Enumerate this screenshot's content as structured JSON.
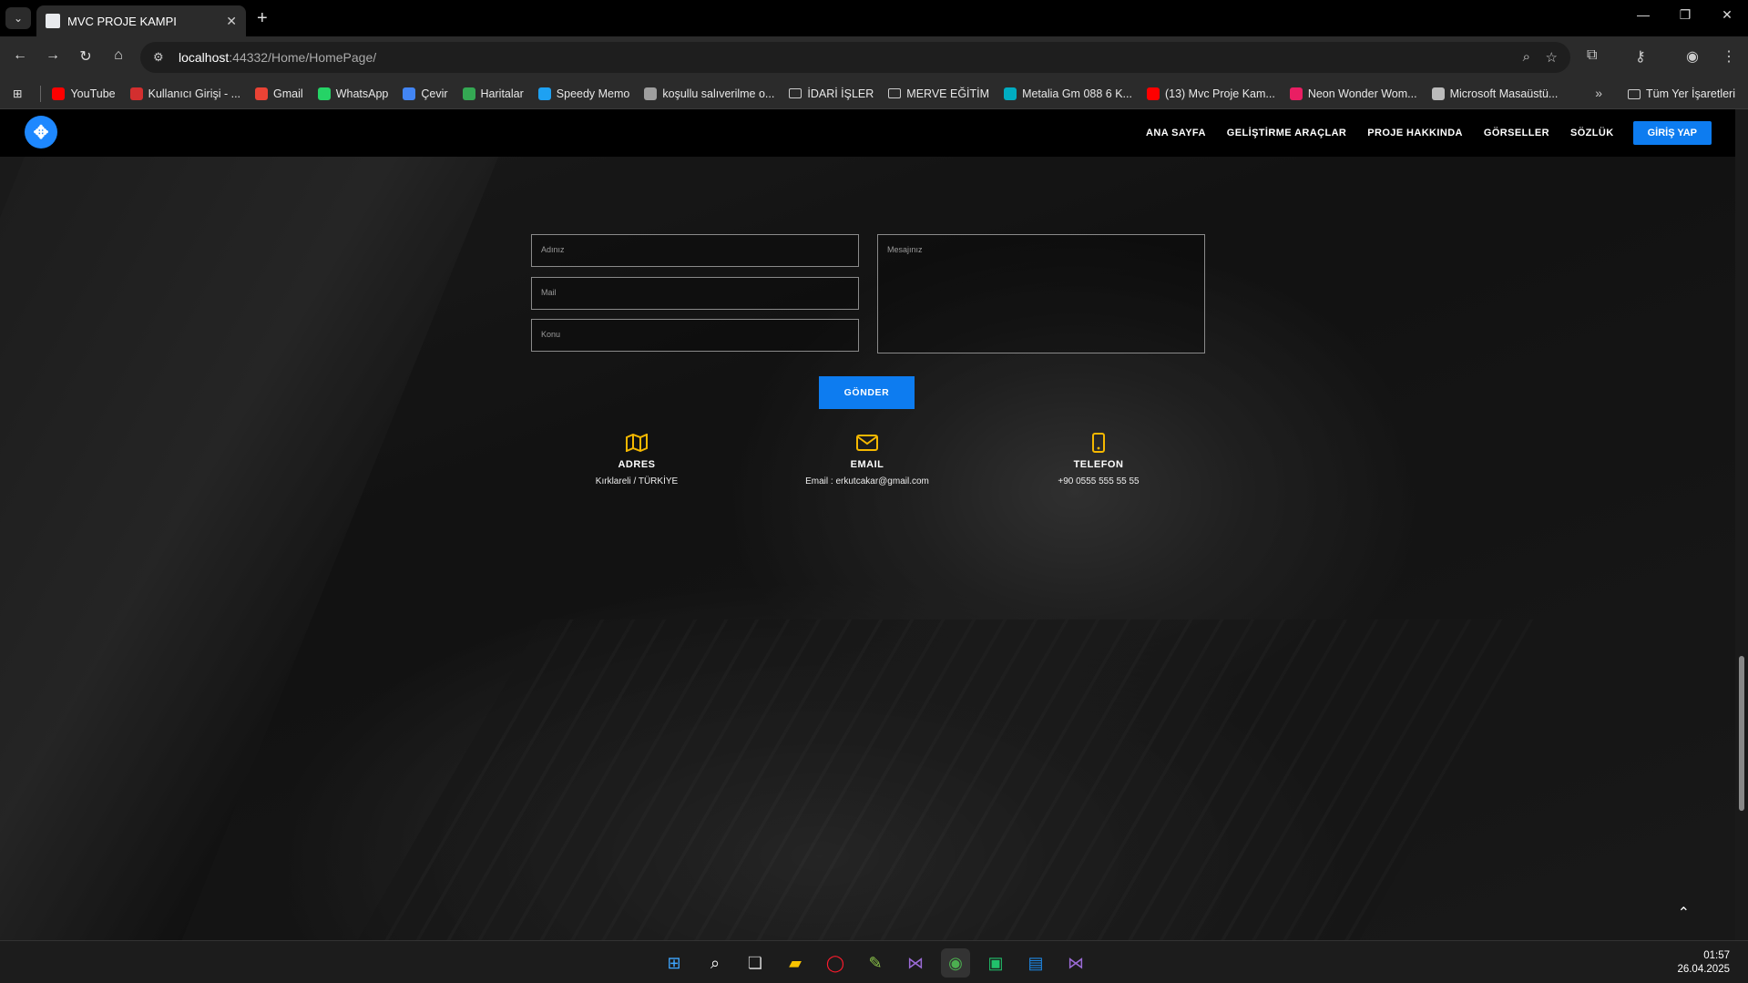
{
  "browser": {
    "tab_title": "MVC PROJE KAMPI",
    "url_host": "localhost",
    "url_rest": ":44332/Home/HomePage/",
    "bookmarks": [
      {
        "label": "YouTube",
        "color": "#ff0000"
      },
      {
        "label": "Kullanıcı Girişi - ...",
        "color": "#d32f2f"
      },
      {
        "label": "Gmail",
        "color": "#ea4335"
      },
      {
        "label": "WhatsApp",
        "color": "#25d366"
      },
      {
        "label": "Çevir",
        "color": "#4285f4"
      },
      {
        "label": "Haritalar",
        "color": "#34a853"
      },
      {
        "label": "Speedy Memo",
        "color": "#1ea1f2"
      },
      {
        "label": "koşullu salıverilme o...",
        "color": "#9e9e9e"
      },
      {
        "label": "İDARİ İŞLER",
        "folder": true
      },
      {
        "label": "MERVE EĞİTİM",
        "folder": true
      },
      {
        "label": "Metalia Gm 088 6 K...",
        "color": "#00acc1"
      },
      {
        "label": "(13) Mvc Proje Kam...",
        "color": "#ff0000"
      },
      {
        "label": "Neon Wonder Wom...",
        "color": "#e91e63"
      },
      {
        "label": "Microsoft Masaüstü...",
        "color": "#bbbbbb"
      }
    ],
    "all_bookmarks_label": "Tüm Yer İşaretleri"
  },
  "site": {
    "nav": {
      "links": [
        "ANA SAYFA",
        "GELİŞTİRME ARAÇLAR",
        "PROJE HAKKINDA",
        "GÖRSELLER",
        "SÖZLÜK"
      ],
      "login_label": "GİRİŞ YAP"
    },
    "form": {
      "name_placeholder": "Adınız",
      "mail_placeholder": "Mail",
      "subject_placeholder": "Konu",
      "message_placeholder": "Mesajınız",
      "send_label": "GÖNDER"
    },
    "contact": {
      "address_title": "ADRES",
      "address_value": "Kırklareli / TÜRKİYE",
      "email_title": "EMAIL",
      "email_value": "Email : erkutcakar@gmail.com",
      "phone_title": "TELEFON",
      "phone_value": "+90 0555 555 55 55"
    },
    "accent_color": "#0d7cf0",
    "icon_color": "#f5b800"
  },
  "taskbar": {
    "time": "01:57",
    "date": "26.04.2025"
  }
}
